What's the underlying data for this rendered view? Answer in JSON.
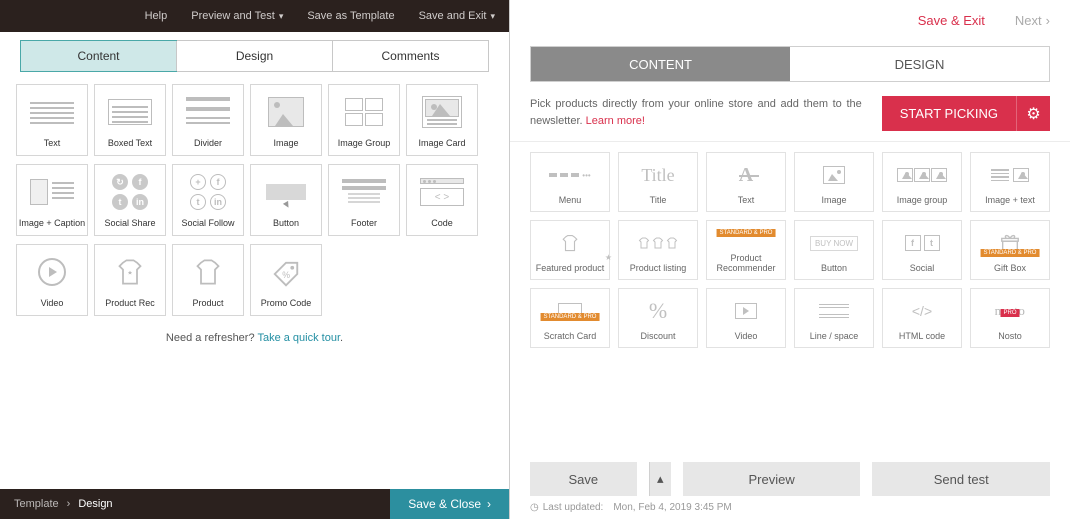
{
  "left": {
    "topnav": {
      "help": "Help",
      "preview": "Preview and Test",
      "saveTemplate": "Save as Template",
      "saveExit": "Save and Exit"
    },
    "tabs": {
      "content": "Content",
      "design": "Design",
      "comments": "Comments"
    },
    "tiles": {
      "text": "Text",
      "boxed": "Boxed Text",
      "divider": "Divider",
      "image": "Image",
      "imageGroup": "Image Group",
      "imageCard": "Image Card",
      "imageCaption": "Image + Caption",
      "socialShare": "Social Share",
      "socialFollow": "Social Follow",
      "button": "Button",
      "footer": "Footer",
      "code": "Code",
      "video": "Video",
      "productRec": "Product Rec",
      "product": "Product",
      "promo": "Promo Code"
    },
    "refresher": {
      "lead": "Need a refresher? ",
      "link": "Take a quick tour"
    },
    "breadcrumb": {
      "template": "Template",
      "design": "Design"
    },
    "saveClose": "Save & Close"
  },
  "right": {
    "top": {
      "saveExit": "Save & Exit",
      "next": "Next"
    },
    "tabs": {
      "content": "CONTENT",
      "design": "DESIGN"
    },
    "picker": {
      "text": "Pick products directly from your online store and add them to the newsletter. ",
      "learn": "Learn more!",
      "button": "START PICKING"
    },
    "tiles": {
      "menu": "Menu",
      "title": "Title",
      "titleSample": "Title",
      "text": "Text",
      "image": "Image",
      "imageGroup": "Image group",
      "imageText": "Image + text",
      "featured": "Featured product",
      "listing": "Product listing",
      "recommender": "Product Recommender",
      "button": "Button",
      "buyNow": "BUY NOW",
      "social": "Social",
      "gift": "Gift Box",
      "scratch": "Scratch Card",
      "discount": "Discount",
      "video": "Video",
      "line": "Line / space",
      "html": "HTML code",
      "nosto": "Nosto",
      "nostoLogo": "nosto"
    },
    "badge": "STANDARD & PRO",
    "badgePro": "PRO",
    "bottom": {
      "save": "Save",
      "preview": "Preview",
      "sendTest": "Send test",
      "updatedLabel": "Last updated:",
      "updatedValue": "Mon, Feb 4, 2019 3:45 PM"
    }
  }
}
